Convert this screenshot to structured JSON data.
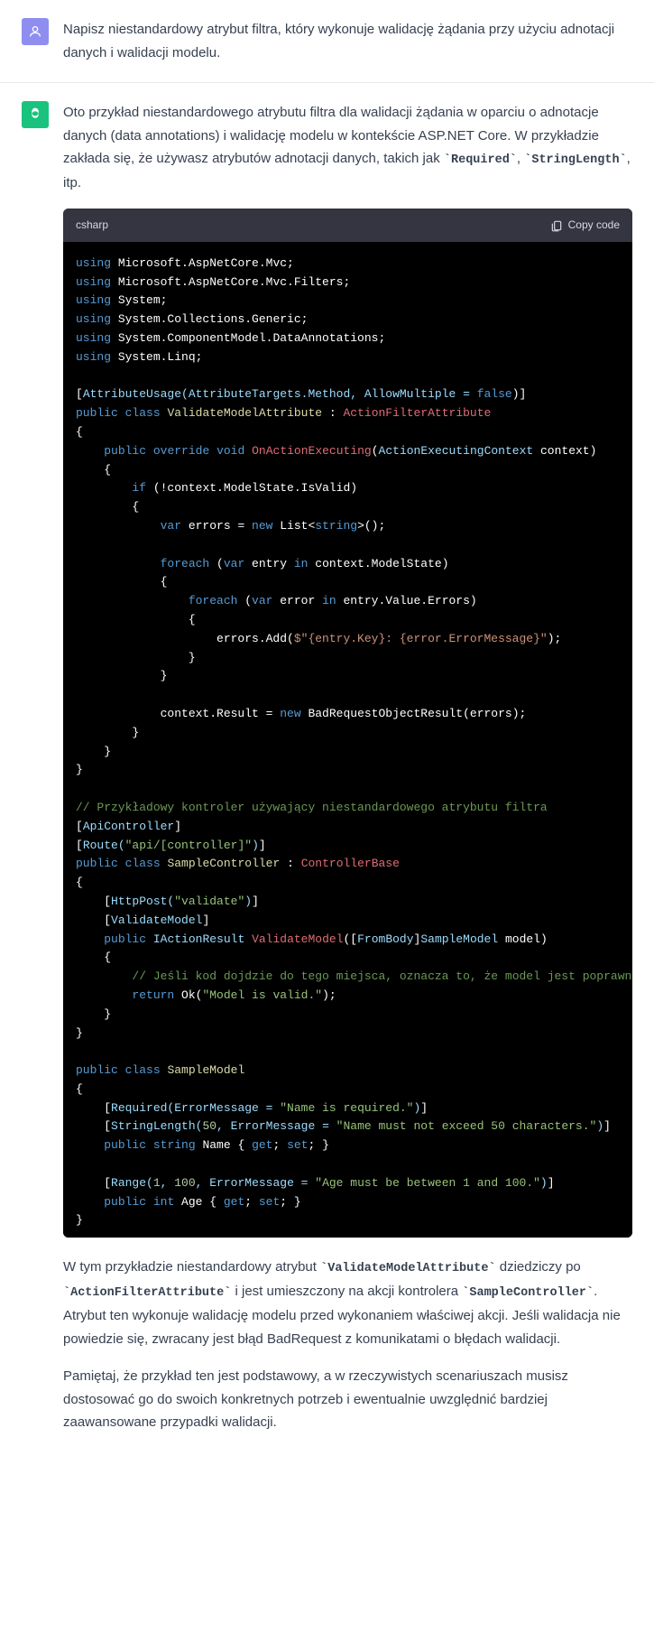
{
  "user": {
    "text": "Napisz niestandardowy atrybut filtra, który wykonuje walidację żądania przy użyciu adnotacji danych i walidacji modelu."
  },
  "assistant": {
    "intro_a": "Oto przykład niestandardowego atrybutu filtra dla walidacji żądania w oparciu o adnotacje danych (data annotations) i walidację modelu w kontekście ASP.NET Core. W przykładzie zakłada się, że używasz atrybutów adnotacji danych, takich jak ",
    "intro_code1": "`Required`",
    "intro_mid": ", ",
    "intro_code2": "`StringLength`",
    "intro_b": ", itp.",
    "code_lang": "csharp",
    "copy_label": "Copy code",
    "outro1_a": "W tym przykładzie niestandardowy atrybut ",
    "outro1_code1": "`ValidateModelAttribute`",
    "outro1_b": " dziedziczy po ",
    "outro1_code2": "`ActionFilterAttribute`",
    "outro1_c": " i jest umieszczony na akcji kontrolera ",
    "outro1_code3": "`SampleController`",
    "outro1_d": ". Atrybut ten wykonuje walidację modelu przed wykonaniem właściwej akcji. Jeśli walidacja nie powiedzie się, zwracany jest błąd BadRequest z komunikatami o błędach walidacji.",
    "outro2": "Pamiętaj, że przykład ten jest podstawowy, a w rzeczywistych scenariuszach musisz dostosować go do swoich konkretnych potrzeb i ewentualnie uwzględnić bardziej zaawansowane przypadki walidacji.",
    "code": {
      "using1": "Microsoft.AspNetCore.Mvc",
      "using2": "Microsoft.AspNetCore.Mvc.Filters",
      "using3": "System",
      "using4": "System.Collections.Generic",
      "using5": "System.ComponentModel.DataAnnotations",
      "using6": "System.Linq",
      "attrUsage": "AttributeUsage(AttributeTargets.Method, AllowMultiple = ",
      "class1": "ValidateModelAttribute",
      "base1": "ActionFilterAttribute",
      "method1": "OnActionExecuting",
      "paramType1": "ActionExecutingContext",
      "cond": "!context.ModelState.IsValid",
      "listType": "string",
      "foreach1": "context.ModelState",
      "foreach2": "entry.Value.Errors",
      "addLine": "errors.Add(",
      "interp": "$\"{entry.Key}: {error.ErrorMessage}\"",
      "resultLine": "context.Result = ",
      "badReq": "BadRequestObjectResult(errors)",
      "cmt1": "// Przykładowy kontroler używający niestandardowego atrybutu filtra",
      "apiCtrl": "ApiController",
      "route": "\"api/[controller]\"",
      "class2": "SampleController",
      "base2": "ControllerBase",
      "httpPost": "\"validate\"",
      "validateModel": "ValidateModel",
      "method2": "ValidateModel",
      "retType": "IActionResult",
      "paramAttr": "FromBody",
      "paramType2": "SampleModel",
      "cmt2": "// Jeśli kod dojdzie do tego miejsca, oznacza to, że model jest poprawny.",
      "okStr": "\"Model is valid.\"",
      "class3": "SampleModel",
      "reqMsg": "\"Name is required.\"",
      "lenMsg": "\"Name must not exceed 50 characters.\"",
      "rangeMsg": "\"Age must be between 1 and 100.\"",
      "prop1": "Name",
      "prop2": "Age"
    }
  }
}
